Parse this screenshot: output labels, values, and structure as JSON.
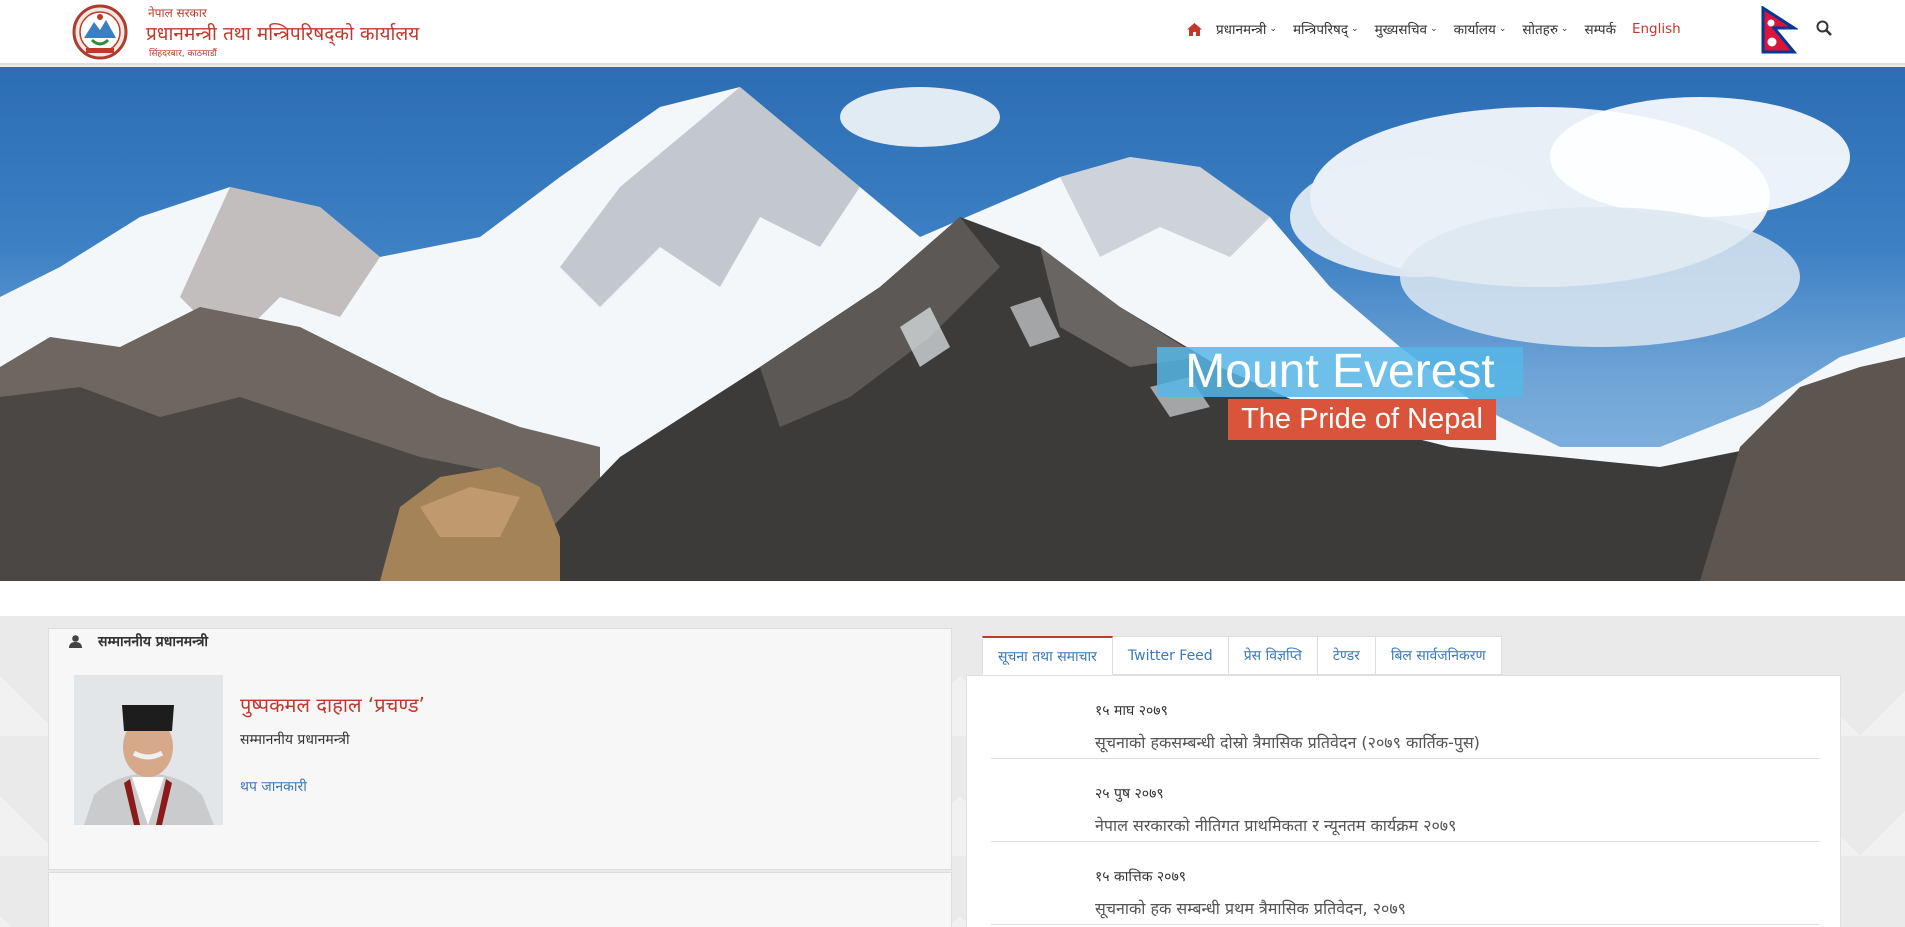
{
  "header": {
    "gov_small": "नेपाल सरकार",
    "office_name": "प्रधानमन्त्री तथा मन्त्रिपरिषद्को कार्यालय",
    "location": "सिंहदरबार, काठमाडौं"
  },
  "nav": {
    "home_icon": "home-icon",
    "items": [
      {
        "label": "प्रधानमन्त्री",
        "has_dropdown": true
      },
      {
        "label": "मन्त्रिपरिषद्",
        "has_dropdown": true
      },
      {
        "label": "मुख्यसचिव",
        "has_dropdown": true
      },
      {
        "label": "कार्यालय",
        "has_dropdown": true
      },
      {
        "label": "सोतहरु",
        "has_dropdown": true
      },
      {
        "label": "सम्पर्क",
        "has_dropdown": false
      }
    ],
    "language": "English",
    "dropdown_chevron": "⌄",
    "search_icon": "search-icon"
  },
  "hero": {
    "title": "Mount Everest",
    "subtitle": "The Pride of Nepal"
  },
  "pm_card": {
    "heading": "सम्माननीय प्रधानमन्त्री",
    "name": "पुष्पकमल दाहाल ‘प्रचण्ड’",
    "title": "सम्माननीय प्रधानमन्त्री",
    "more_link": "थप जानकारी"
  },
  "tabs": [
    {
      "label": "सूचना तथा समाचार",
      "active": true
    },
    {
      "label": "Twitter Feed",
      "active": false
    },
    {
      "label": "प्रेस विज्ञप्ति",
      "active": false
    },
    {
      "label": "टेण्डर",
      "active": false
    },
    {
      "label": "बिल सार्वजनिकरण",
      "active": false
    }
  ],
  "news": [
    {
      "date": "१५ माघ २०७९",
      "title": "सूचनाको हकसम्बन्धी दोस्रो त्रैमासिक प्रतिवेदन (२०७९ कार्तिक-पुस)"
    },
    {
      "date": "२५ पुष २०७९",
      "title": "नेपाल सरकारको नीतिगत प्राथमिकता र न्यूनतम कार्यक्रम २०७९"
    },
    {
      "date": "१५ कात्तिक २०७९",
      "title": "सूचनाको हक सम्बन्धी प्रथम त्रैमासिक प्रतिवेदन, २०७९"
    }
  ],
  "colors": {
    "brand_red": "#c0392b",
    "link_blue": "#3a78b8",
    "hero_title_bg": "#56b6e6",
    "hero_sub_bg": "#d9543a"
  }
}
